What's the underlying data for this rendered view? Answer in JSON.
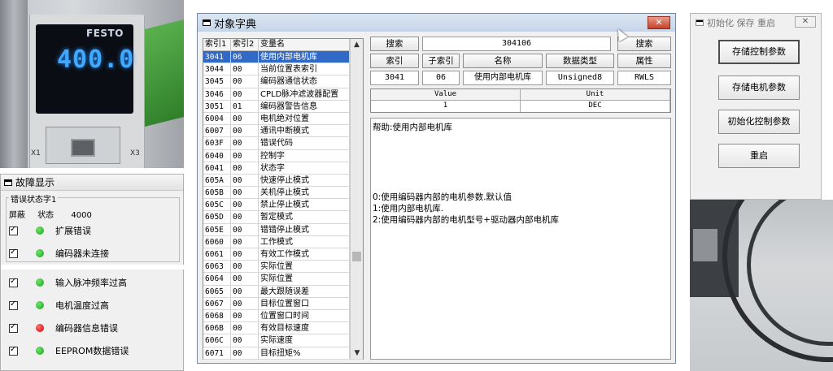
{
  "photo": {
    "brand": "FESTO",
    "display_value": "400.0",
    "label_x1": "X1",
    "label_x3": "X3"
  },
  "fault_window": {
    "title": "故障显示",
    "group_title": "错误状态字1",
    "col_mask": "屏蔽",
    "col_status": "状态",
    "status_value": "4000",
    "items": [
      {
        "label": "扩展错误",
        "checked": true,
        "led": "green"
      },
      {
        "label": "编码器未连接",
        "checked": true,
        "led": "green"
      },
      {
        "label": "输入脉冲频率过高",
        "checked": true,
        "led": "green"
      },
      {
        "label": "电机温度过高",
        "checked": true,
        "led": "green"
      },
      {
        "label": "编码器信息错误",
        "checked": true,
        "led": "red"
      },
      {
        "label": "EEPROM数据错误",
        "checked": true,
        "led": "green"
      }
    ]
  },
  "dict_window": {
    "title": "对象字典",
    "close_label": "✕",
    "list_headers": [
      "索引1",
      "索引2",
      "变量名"
    ],
    "rows": [
      [
        "3041",
        "06",
        "使用内部电机库"
      ],
      [
        "3044",
        "00",
        "当前位置表索引"
      ],
      [
        "3045",
        "00",
        "编码器通信状态"
      ],
      [
        "3046",
        "00",
        "CPLD脉冲滤波器配置"
      ],
      [
        "3051",
        "01",
        "编码器警告信息"
      ],
      [
        "6004",
        "00",
        "电机绝对位置"
      ],
      [
        "6007",
        "00",
        "通讯中断模式"
      ],
      [
        "603F",
        "00",
        "错误代码"
      ],
      [
        "6040",
        "00",
        "控制字"
      ],
      [
        "6041",
        "00",
        "状态字"
      ],
      [
        "605A",
        "00",
        "快速停止模式"
      ],
      [
        "605B",
        "00",
        "关机停止模式"
      ],
      [
        "605C",
        "00",
        "禁止停止模式"
      ],
      [
        "605D",
        "00",
        "暂定模式"
      ],
      [
        "605E",
        "00",
        "错错停止模式"
      ],
      [
        "6060",
        "00",
        "工作模式"
      ],
      [
        "6061",
        "00",
        "有效工作模式"
      ],
      [
        "6063",
        "00",
        "实际位置"
      ],
      [
        "6064",
        "00",
        "实际位置"
      ],
      [
        "6065",
        "00",
        "最大跟随误差"
      ],
      [
        "6067",
        "00",
        "目标位置窗口"
      ],
      [
        "6068",
        "00",
        "位置窗口时间"
      ],
      [
        "606B",
        "00",
        "有效目标速度"
      ],
      [
        "606C",
        "00",
        "实际速度"
      ],
      [
        "6071",
        "00",
        "目标扭矩%"
      ]
    ],
    "search_label": "搜索",
    "search_value": "304106",
    "search_button": "搜索",
    "hdr_index": "索引",
    "hdr_subindex": "子索引",
    "hdr_name": "名称",
    "hdr_type": "数据类型",
    "props_button": "属性",
    "val_index": "3041",
    "val_subindex": "06",
    "val_name": "使用内部电机库",
    "val_type": "Unsigned8",
    "val_access": "RWLS",
    "value_header": "Value",
    "unit_header": "Unit",
    "value_value": "1",
    "unit_value": "DEC",
    "help_title": "帮助:使用内部电机库",
    "help_lines": [
      "0:使用编码器内部的电机参数.默认值",
      "1:使用内部电机库.",
      "2:使用编码器内部的电机型号+驱动器内部电机库"
    ]
  },
  "init_window": {
    "title": "初始化 保存 重启",
    "close_label": "✕",
    "buttons": [
      "存储控制参数",
      "存储电机参数",
      "初始化控制参数",
      "重启"
    ]
  }
}
